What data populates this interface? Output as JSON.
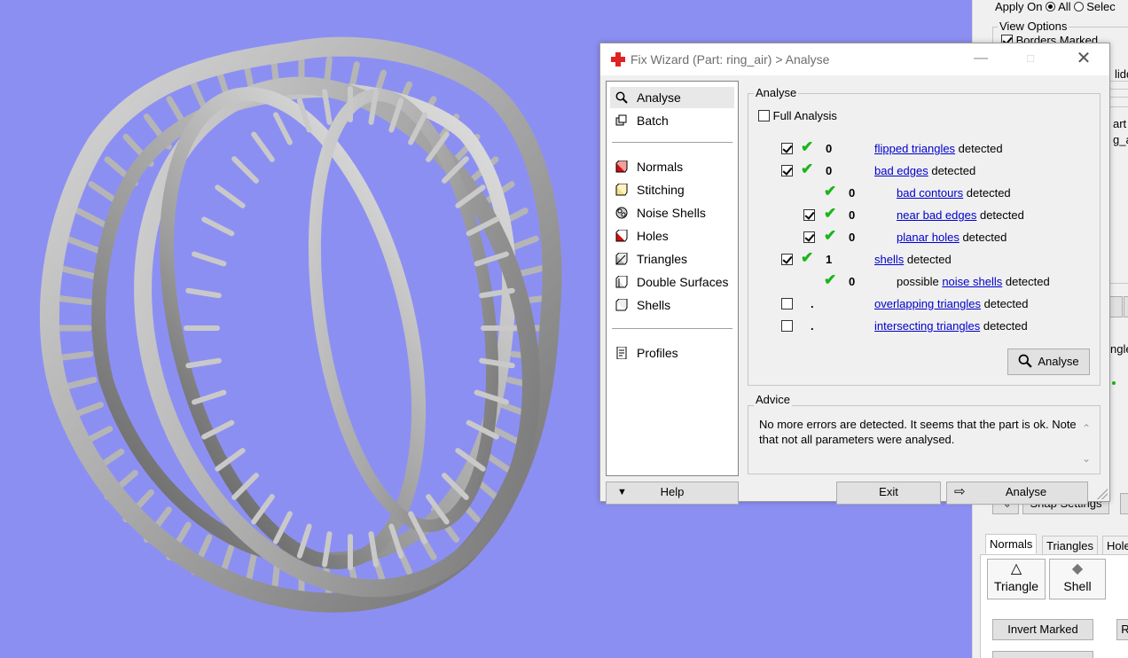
{
  "right_panel": {
    "apply_on_label": "Apply On",
    "radio_all": "All",
    "radio_selected": "Selec",
    "view_options_label": "View Options",
    "borders_marked": "Borders Marked",
    "hidden_partial": "lidd",
    "art_partial": "art I",
    "name_partial": "g_a",
    "ngle_partial": "ngle",
    "snap_settings": "Snap Settings",
    "tabs": [
      "Normals",
      "Triangles",
      "Hole"
    ],
    "triangle_btn": "Triangle",
    "shell_btn": "Shell",
    "invert_marked": "Invert Marked",
    "r_partial": "R"
  },
  "dialog": {
    "title": "Fix Wizard (Part: ring_air) > Analyse",
    "nav": {
      "analyse": "Analyse",
      "batch": "Batch",
      "normals": "Normals",
      "stitching": "Stitching",
      "noise_shells": "Noise Shells",
      "holes": "Holes",
      "triangles": "Triangles",
      "double_surfaces": "Double Surfaces",
      "shells": "Shells",
      "profiles": "Profiles"
    },
    "analyse_group": "Analyse",
    "full_analysis": "Full Analysis",
    "detected": "detected",
    "possible": "possible",
    "rows": [
      {
        "count": "0",
        "link": "flipped triangles"
      },
      {
        "count": "0",
        "link": "bad edges"
      },
      {
        "count": "0",
        "link": "bad contours"
      },
      {
        "count": "0",
        "link": "near bad edges"
      },
      {
        "count": "0",
        "link": "planar holes"
      },
      {
        "count": "1",
        "link": "shells"
      },
      {
        "count": "0",
        "link": "noise shells"
      },
      {
        "count": ".",
        "link": "overlapping triangles"
      },
      {
        "count": ".",
        "link": "intersecting triangles"
      }
    ],
    "analyse_button": "Analyse",
    "advice_group": "Advice",
    "advice_text": "No more errors are detected. It seems that the part is ok. Note that not all parameters were analysed.",
    "help_button": "Help",
    "exit_button": "Exit",
    "analyse_footer_button": "Analyse"
  }
}
